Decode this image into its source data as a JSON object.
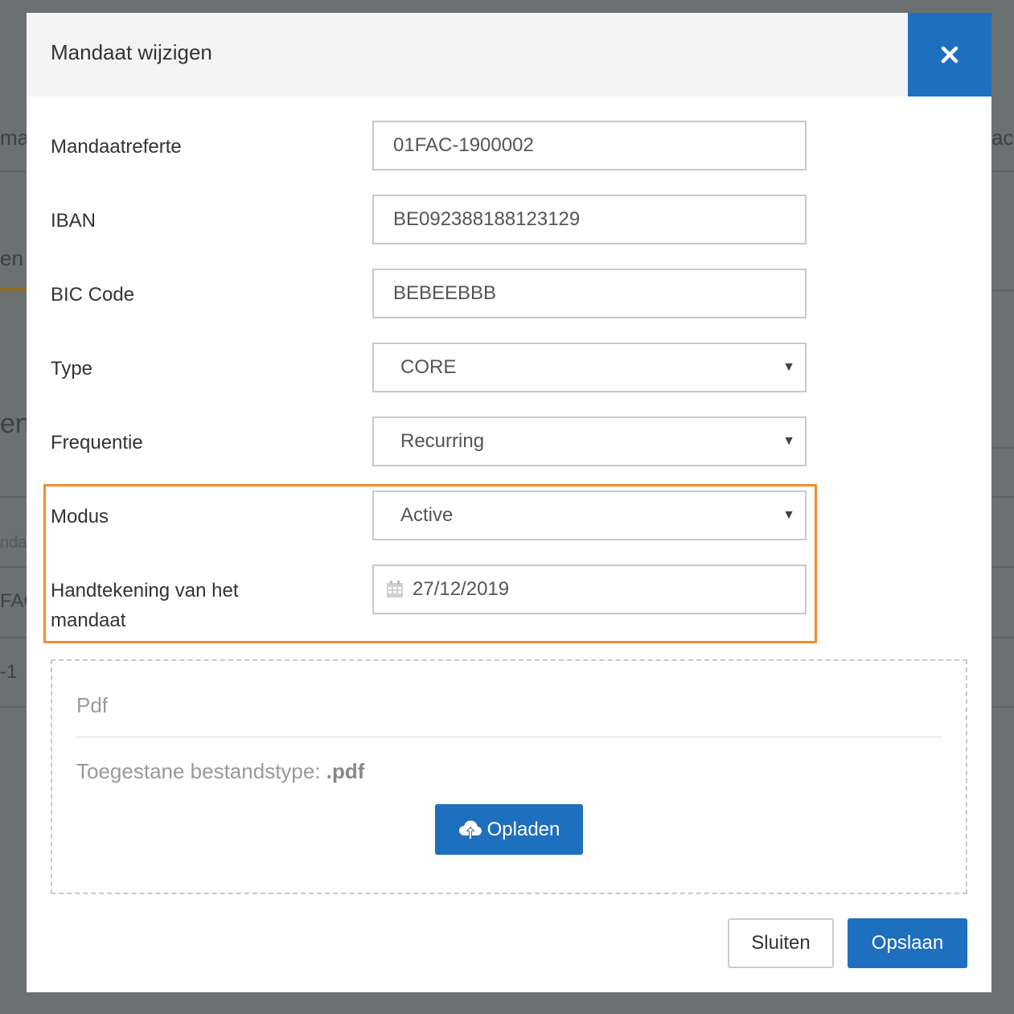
{
  "background": {
    "fragments": [
      "mar",
      "ack",
      "en",
      "en",
      "nda",
      "FAC",
      "-1"
    ]
  },
  "modal": {
    "title": "Mandaat wijzigen",
    "close_icon": "close-icon"
  },
  "form": {
    "reference": {
      "label": "Mandaatreferte",
      "value": "01FAC-1900002"
    },
    "iban": {
      "label": "IBAN",
      "value": "BE092388188123129"
    },
    "bic": {
      "label": "BIC Code",
      "value": "BEBEEBBB"
    },
    "type": {
      "label": "Type",
      "value": "CORE"
    },
    "frequency": {
      "label": "Frequentie",
      "value": "Recurring"
    },
    "mode": {
      "label": "Modus",
      "value": "Active"
    },
    "signature": {
      "label": "Handtekening van het mandaat",
      "value": "27/12/2019",
      "icon": "calendar-icon"
    }
  },
  "upload": {
    "title": "Pdf",
    "hint_prefix": "Toegestane bestandstype:",
    "hint_ext": ".pdf",
    "button_label": "Opladen",
    "button_icon": "cloud-upload-icon"
  },
  "footer": {
    "close_label": "Sluiten",
    "save_label": "Opslaan"
  },
  "colors": {
    "primary": "#1f6fbf",
    "highlight": "#f58a2c",
    "overlay": "#6b7172"
  }
}
